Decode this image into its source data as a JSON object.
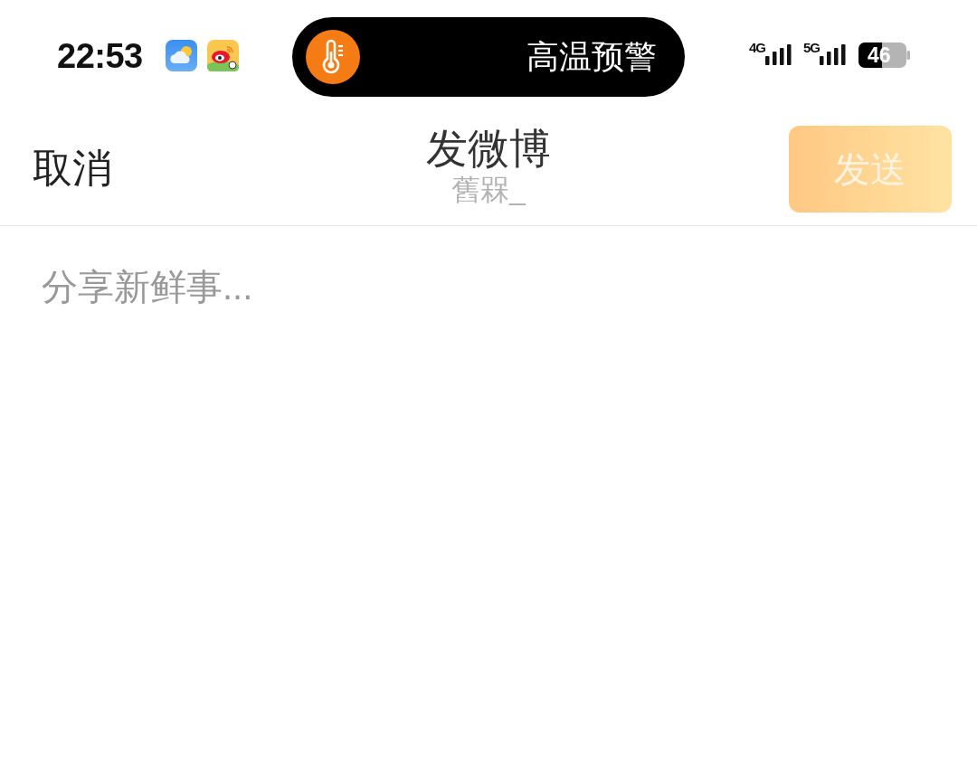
{
  "status_bar": {
    "time": "22:53",
    "alert": "高温预警",
    "networks": [
      "4G",
      "5G"
    ],
    "battery": "46"
  },
  "header": {
    "cancel": "取消",
    "title": "发微博",
    "subtitle": "舊槑_",
    "send_button": {
      "label": "发送",
      "disabled": true
    }
  },
  "composer": {
    "placeholder": "分享新鲜事..."
  }
}
